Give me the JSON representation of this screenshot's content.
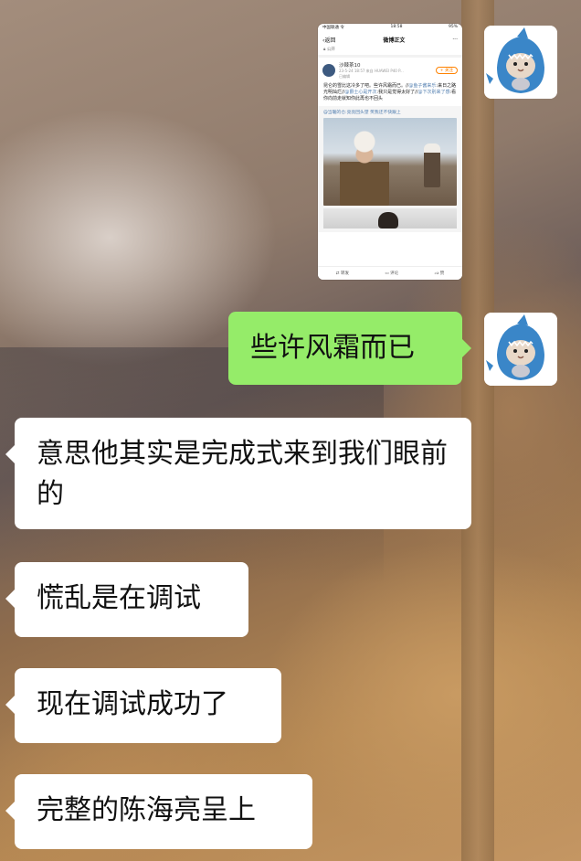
{
  "colors": {
    "self_bubble": "#95ec69",
    "other_bubble": "#ffffff",
    "weibo_link": "#507daf",
    "weibo_follow": "#ff8200"
  },
  "self_avatar": {
    "icon": "shark-hood-hamster-avatar-icon"
  },
  "screenshot": {
    "status_left": "中国联通 令",
    "status_time": "18:58",
    "status_right": "95%",
    "back_label": "返回",
    "page_title": "微博正文",
    "more_icon": "ellipsis-icon",
    "visibility": "公开",
    "username": "沙棘茶10",
    "post_time": "23-5-24 18:57 来自 HUAWEI P40 P...",
    "edited": "已编辑",
    "follow_label": "+ 关注",
    "post_text_1": "昆仑的雪比这冷多了吧。些许风霜而已。//",
    "post_text_2": "@鱼子酱来乐",
    "post_text_3": ":来日之路光明灿烂//",
    "post_text_4": "@爵士心是开次",
    "post_text_5": ":我只是觉得太好了//",
    "post_text_6": "@下次别来了感",
    "post_text_7": ":看你向前走就知你此再也不回头",
    "retweet_text": "@当暖的仓:亮亮回头望 笑我还不快跟上",
    "action_repost": "转发",
    "action_comment": "评论",
    "action_like": "赞"
  },
  "messages": [
    {
      "side": "right",
      "text": "些许风霜而已"
    },
    {
      "side": "left",
      "text": "意思他其实是完成式来到我们眼前的"
    },
    {
      "side": "left",
      "text": "慌乱是在调试"
    },
    {
      "side": "left",
      "text": "现在调试成功了"
    },
    {
      "side": "left",
      "text": "完整的陈海亮呈上"
    }
  ]
}
